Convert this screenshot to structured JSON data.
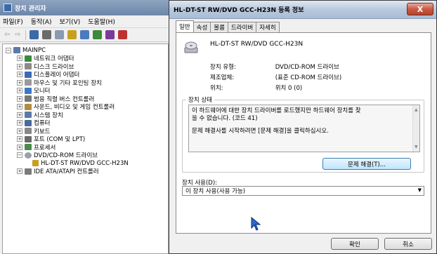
{
  "device_manager": {
    "title": "장치 관리자",
    "menu": [
      "파일(F)",
      "동작(A)",
      "보기(V)",
      "도움말(H)"
    ],
    "tree": {
      "root": "MAINPC",
      "categories": [
        {
          "label": "네트워크 어댑터",
          "color": "#3c8a3c"
        },
        {
          "label": "디스크 드라이브",
          "color": "#8a8a8a"
        },
        {
          "label": "디스플레이 어댑터",
          "color": "#3c6ab4"
        },
        {
          "label": "마우스 및 기타 포인팅 장치",
          "color": "#9a9a9a"
        },
        {
          "label": "모니터",
          "color": "#3c78c8"
        },
        {
          "label": "범용 직렬 버스 컨트롤러",
          "color": "#777777"
        },
        {
          "label": "사운드, 비디오 및 게임 컨트롤러",
          "color": "#b48c3c"
        },
        {
          "label": "시스템 장치",
          "color": "#5a7aa8"
        },
        {
          "label": "컴퓨터",
          "color": "#4a6a9a"
        },
        {
          "label": "키보드",
          "color": "#888888"
        },
        {
          "label": "포트 (COM 및 LPT)",
          "color": "#6a6a6a"
        },
        {
          "label": "프로세서",
          "color": "#4a8a4a"
        },
        {
          "label": "DVD/CD-ROM 드라이브",
          "color": "#9aa0a8"
        },
        {
          "label": "IDE ATA/ATAPI 컨트롤러",
          "color": "#7a7a7a"
        }
      ],
      "expanded_child": "HL-DT-ST RW/DVD GCC-H23N"
    }
  },
  "dialog": {
    "title": "HL-DT-ST RW/DVD GCC-H23N 등록 정보",
    "close_label": "X",
    "tabs": [
      "일반",
      "속성",
      "볼륨",
      "드라이버",
      "자세히"
    ],
    "device_name": "HL-DT-ST RW/DVD GCC-H23N",
    "info": {
      "type_label": "장치 유형:",
      "type_value": "DVD/CD-ROM 드라이브",
      "mfr_label": "제조업체:",
      "mfr_value": "(표준 CD-ROM 드라이브)",
      "loc_label": "위치:",
      "loc_value": "위치 0 (0)"
    },
    "status_title": "장치 상태",
    "status_line1": "이 하드웨어에 대한 장치 드라이버를 로드했지만 하드웨어 장치를 찾",
    "status_line2": "을 수 없습니다. (코드 41)",
    "status_line3": "문제 해결사를 시작하려면 [문제 해결]을 클릭하십시오.",
    "troubleshoot_label": "문제 해결(T)...",
    "usage_label": "장치 사용(D):",
    "usage_value": "이 장치 사용(사용 가능)",
    "ok_label": "확인",
    "cancel_label": "취소"
  }
}
